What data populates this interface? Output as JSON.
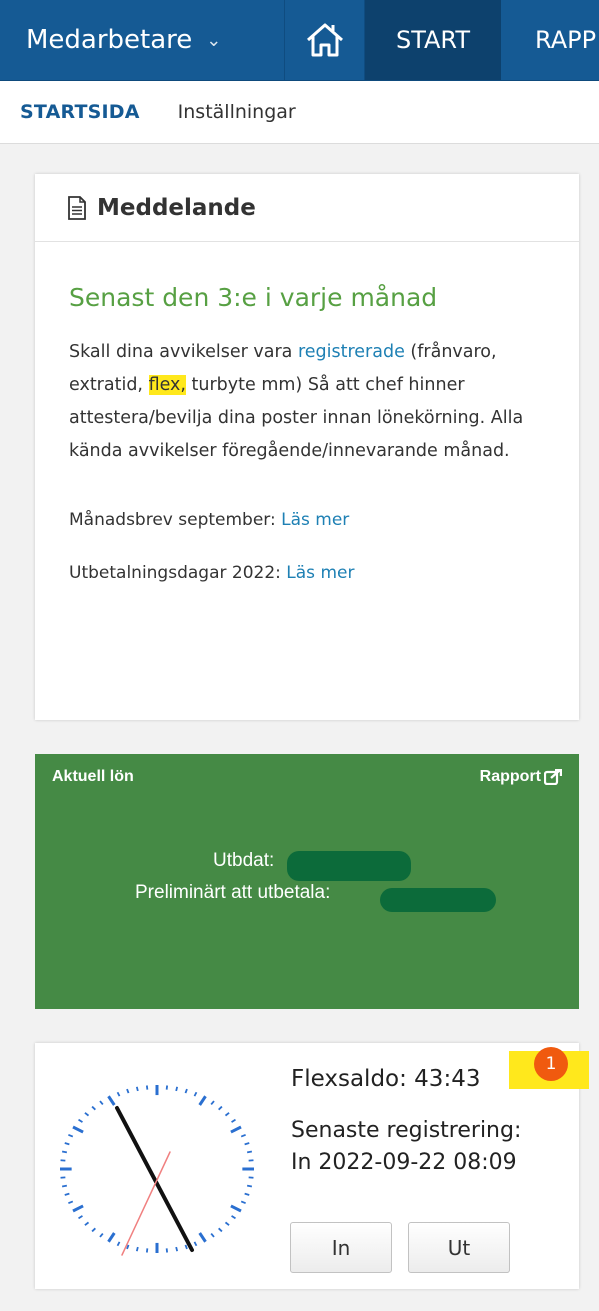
{
  "nav": {
    "app_name": "Medarbetare",
    "tab_start": "START",
    "tab_next": "RAPP"
  },
  "subnav": {
    "active": "STARTSIDA",
    "settings": "Inställningar"
  },
  "message": {
    "header": "Meddelande",
    "title": "Senast den 3:e i varje månad",
    "text_1": "Skall dina avvikelser vara ",
    "text_link": "registrerade",
    "text_2": " (frånvaro, extratid, ",
    "text_hl": "flex,",
    "text_3": " turbyte mm) Så att chef hinner attestera/bevilja dina poster innan lönekörning. Alla kända avvikelser föregående/innevarande månad.",
    "line1_label": "Månadsbrev september: ",
    "line1_link": "Läs mer",
    "line2_label": "Utbetalningsdagar 2022: ",
    "line2_link": "Läs mer"
  },
  "salary": {
    "title": "Aktuell lön",
    "report": "Rapport",
    "paid_label": "Utbdat:",
    "prelim_label": "Preliminärt att utbetala:"
  },
  "flex": {
    "saldo": "Flexsaldo: 43:43",
    "last_label": "Senaste registrering:",
    "last_value": "In 2022-09-22 08:09",
    "badge": "1",
    "btn_in": "In",
    "btn_out": "Ut"
  },
  "colors": {
    "nav_bg": "#155a94",
    "accent_green": "#57a043",
    "salary_bg": "#458a45",
    "link": "#1e80b4",
    "badge": "#f05a0f"
  }
}
